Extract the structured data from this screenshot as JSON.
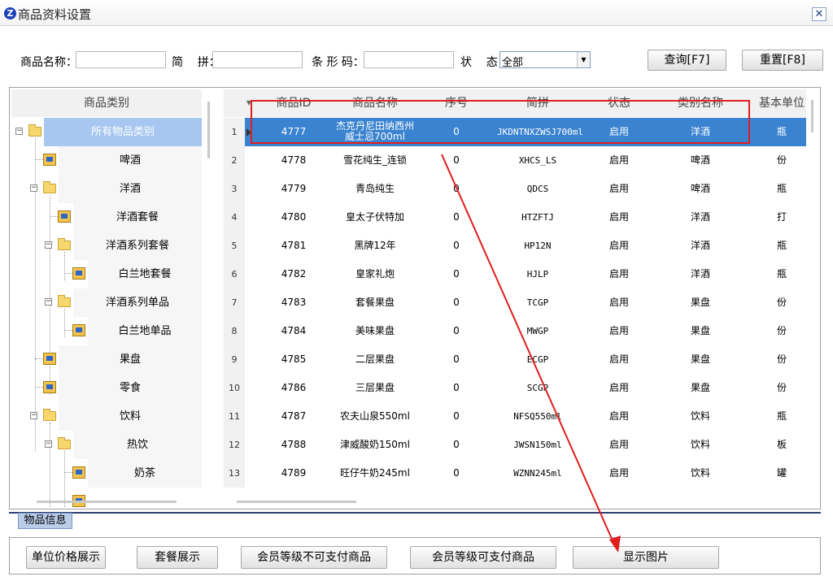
{
  "window": {
    "title": "商品资料设置",
    "logo_letter": "Z",
    "close_glyph": "✕"
  },
  "search": {
    "name_label": "商品名称：",
    "pinyin_label": "简    拼：",
    "barcode_label": "条 形 码：",
    "status_label": "状    态：",
    "name_value": "",
    "pinyin_value": "",
    "barcode_value": "",
    "status_value": "全部",
    "query_button": "查询[F7]",
    "reset_button": "重置[F8]"
  },
  "tree": {
    "header": "商品类别",
    "nodes": [
      {
        "label": "所有物品类别",
        "kind": "folder",
        "expanded": true,
        "selected": true
      },
      {
        "label": "啤酒",
        "kind": "leaf"
      },
      {
        "label": "洋酒",
        "kind": "folder",
        "expanded": true
      },
      {
        "label": "洋酒套餐",
        "kind": "leaf"
      },
      {
        "label": "洋酒系列套餐",
        "kind": "folder",
        "expanded": true
      },
      {
        "label": "白兰地套餐",
        "kind": "leaf"
      },
      {
        "label": "洋酒系列单品",
        "kind": "folder",
        "expanded": true
      },
      {
        "label": "白兰地单品",
        "kind": "leaf"
      },
      {
        "label": "果盘",
        "kind": "leaf"
      },
      {
        "label": "零食",
        "kind": "leaf"
      },
      {
        "label": "饮料",
        "kind": "folder",
        "expanded": true
      },
      {
        "label": "热饮",
        "kind": "folder",
        "expanded": true
      },
      {
        "label": "奶茶",
        "kind": "leaf"
      }
    ]
  },
  "grid": {
    "columns": [
      "商品ID",
      "商品名称",
      "序号",
      "简拼",
      "状态",
      "类别名称",
      "基本单位"
    ],
    "rows": [
      {
        "num": "1",
        "id": "4777",
        "name": "杰克丹尼田纳西州威士忌700ml",
        "seq": "0",
        "pinyin": "JKDNTNXZWSJ700ml",
        "status": "启用",
        "category": "洋酒",
        "unit": "瓶",
        "selected": true
      },
      {
        "num": "2",
        "id": "4778",
        "name": "雪花纯生_连锁",
        "seq": "0",
        "pinyin": "XHCS_LS",
        "status": "启用",
        "category": "啤酒",
        "unit": "份"
      },
      {
        "num": "3",
        "id": "4779",
        "name": "青岛纯生",
        "seq": "0",
        "pinyin": "QDCS",
        "status": "启用",
        "category": "啤酒",
        "unit": "瓶"
      },
      {
        "num": "4",
        "id": "4780",
        "name": "皇太子伏特加",
        "seq": "0",
        "pinyin": "HTZFTJ",
        "status": "启用",
        "category": "洋酒",
        "unit": "打"
      },
      {
        "num": "5",
        "id": "4781",
        "name": "黑牌12年",
        "seq": "0",
        "pinyin": "HP12N",
        "status": "启用",
        "category": "洋酒",
        "unit": "瓶"
      },
      {
        "num": "6",
        "id": "4782",
        "name": "皇家礼炮",
        "seq": "0",
        "pinyin": "HJLP",
        "status": "启用",
        "category": "洋酒",
        "unit": "瓶"
      },
      {
        "num": "7",
        "id": "4783",
        "name": "套餐果盘",
        "seq": "0",
        "pinyin": "TCGP",
        "status": "启用",
        "category": "果盘",
        "unit": "份"
      },
      {
        "num": "8",
        "id": "4784",
        "name": "美味果盘",
        "seq": "0",
        "pinyin": "MWGP",
        "status": "启用",
        "category": "果盘",
        "unit": "份"
      },
      {
        "num": "9",
        "id": "4785",
        "name": "二层果盘",
        "seq": "0",
        "pinyin": "ECGP",
        "status": "启用",
        "category": "果盘",
        "unit": "份"
      },
      {
        "num": "10",
        "id": "4786",
        "name": "三层果盘",
        "seq": "0",
        "pinyin": "SCGP",
        "status": "启用",
        "category": "果盘",
        "unit": "份"
      },
      {
        "num": "11",
        "id": "4787",
        "name": "农夫山泉550ml",
        "seq": "0",
        "pinyin": "NFSQ550ml",
        "status": "启用",
        "category": "饮料",
        "unit": "瓶"
      },
      {
        "num": "12",
        "id": "4788",
        "name": "津威酸奶150ml",
        "seq": "0",
        "pinyin": "JWSN150ml",
        "status": "启用",
        "category": "饮料",
        "unit": "板"
      },
      {
        "num": "13",
        "id": "4789",
        "name": "旺仔牛奶245ml",
        "seq": "0",
        "pinyin": "WZNN245ml",
        "status": "启用",
        "category": "饮料",
        "unit": "罐"
      }
    ]
  },
  "tabs": {
    "active": "物品信息"
  },
  "bottom_buttons": {
    "unit_price": "单位价格展示",
    "package": "套餐展示",
    "member_no_pay": "会员等级不可支付商品",
    "member_pay": "会员等级可支付商品",
    "show_image": "显示图片"
  },
  "colors": {
    "selection_row": "#3a83d0",
    "selection_tree": "#a7c7f0",
    "annotation": "#e01d1d",
    "tab_active": "#b9cde8"
  }
}
